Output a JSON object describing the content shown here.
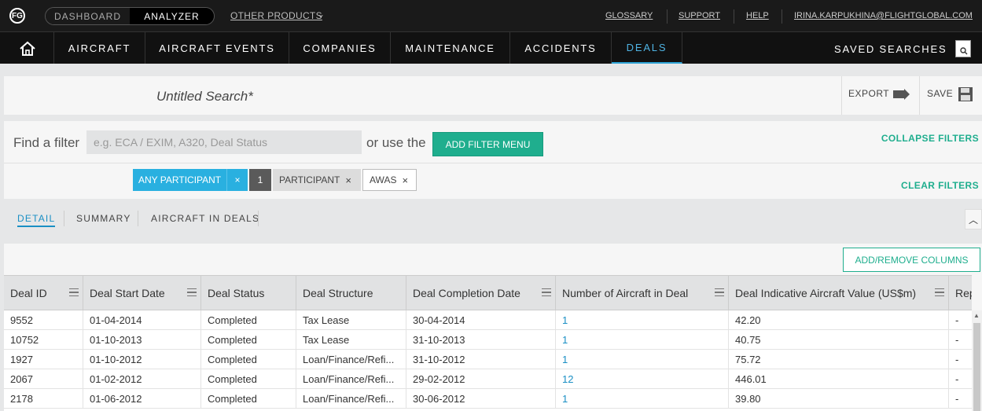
{
  "topbar": {
    "logo": "FG",
    "segment": [
      "DASHBOARD",
      "ANALYZER"
    ],
    "other_products": "OTHER PRODUCTS",
    "links": [
      "GLOSSARY",
      "SUPPORT",
      "HELP",
      "IRINA.KARPUKHINA@FLIGHTGLOBAL.COM"
    ]
  },
  "nav": {
    "items": [
      "AIRCRAFT",
      "AIRCRAFT EVENTS",
      "COMPANIES",
      "MAINTENANCE",
      "ACCIDENTS",
      "DEALS"
    ],
    "active": "DEALS",
    "saved_searches": "SAVED SEARCHES"
  },
  "search": {
    "title": "Untitled Search*",
    "export": "EXPORT",
    "save": "SAVE"
  },
  "filters": {
    "find_label": "Find a filter",
    "placeholder": "e.g. ECA / EXIM, A320, Deal Status",
    "or_use": "or use the",
    "add_filter_menu": "ADD FILTER MENU",
    "collapse": "COLLAPSE FILTERS",
    "clear": "CLEAR FILTERS",
    "chips": {
      "any_participant": "ANY PARTICIPANT",
      "count": "1",
      "participant": "PARTICIPANT",
      "value": "AWAS",
      "remove": "×"
    }
  },
  "subtabs": [
    "DETAIL",
    "SUMMARY",
    "AIRCRAFT IN DEALS"
  ],
  "grid": {
    "add_remove": "ADD/REMOVE COLUMNS",
    "columns": [
      "Deal ID",
      "Deal Start Date",
      "Deal Status",
      "Deal Structure",
      "Deal Completion Date",
      "Number of Aircraft in Deal",
      "Deal Indicative Aircraft Value (US$m)",
      "Rep"
    ],
    "rows": [
      [
        "9552",
        "01-04-2014",
        "Completed",
        "Tax Lease",
        "30-04-2014",
        "1",
        "42.20",
        "-"
      ],
      [
        "10752",
        "01-10-2013",
        "Completed",
        "Tax Lease",
        "31-10-2013",
        "1",
        "40.75",
        "-"
      ],
      [
        "1927",
        "01-10-2012",
        "Completed",
        "Loan/Finance/Refi...",
        "31-10-2012",
        "1",
        "75.72",
        "-"
      ],
      [
        "2067",
        "01-02-2012",
        "Completed",
        "Loan/Finance/Refi...",
        "29-02-2012",
        "12",
        "446.01",
        "-"
      ],
      [
        "2178",
        "01-06-2012",
        "Completed",
        "Loan/Finance/Refi...",
        "30-06-2012",
        "1",
        "39.80",
        "-"
      ]
    ]
  }
}
